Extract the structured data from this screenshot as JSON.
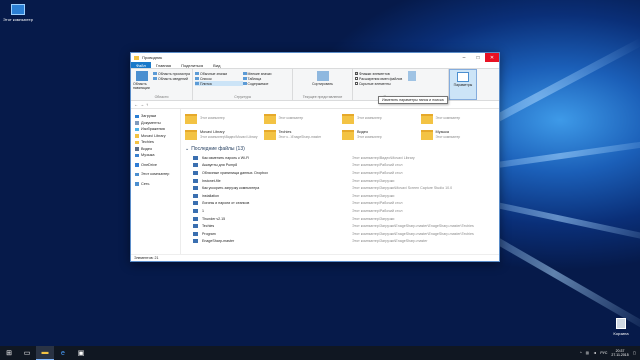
{
  "desktop": {
    "computer_icon_label": "Этот компьютер",
    "recycle_bin_label": "Корзина"
  },
  "window": {
    "title": "Проводник",
    "tabs": [
      "Файл",
      "Главная",
      "Поделиться",
      "Вид"
    ],
    "ribbon": {
      "nav_pane_label": "Область навигации",
      "pane_items": [
        "Область просмотра",
        "Область сведений"
      ],
      "pane_group_label": "Области",
      "layout_items": [
        "Обычные значки",
        "Мелкие значки",
        "Список",
        "Таблица",
        "Плитка",
        "Содержимое"
      ],
      "layout_group_label": "Структура",
      "current_view_label": "Сортировать",
      "current_view_group_label": "Текущее представление",
      "show_items": [
        {
          "label": "Флажки элементов",
          "checked": true
        },
        {
          "label": "Расширения имен файлов",
          "checked": false
        },
        {
          "label": "Скрытые элементы",
          "checked": false
        }
      ],
      "hide_button_label": "Скрыть выбранные элементы",
      "show_group_label": "Показать или скрыть",
      "options_button_label": "Параметры"
    },
    "tooltip": "Изменить параметры папок и поиска"
  },
  "nav": {
    "items": [
      {
        "label": "Загрузки",
        "icon": "download-icon"
      },
      {
        "label": "Документы",
        "icon": "documents-icon"
      },
      {
        "label": "Изображения",
        "icon": "pictures-icon"
      },
      {
        "label": "Movavi Library",
        "icon": "folder-icon"
      },
      {
        "label": "Techies",
        "icon": "folder-icon"
      },
      {
        "label": "Видео",
        "icon": "video-icon"
      },
      {
        "label": "Музыка",
        "icon": "music-icon"
      },
      {
        "label": "OneDrive",
        "icon": "cloud-icon"
      },
      {
        "label": "Этот компьютер",
        "icon": "computer-icon"
      },
      {
        "label": "Сеть",
        "icon": "network-icon"
      }
    ]
  },
  "folders": [
    {
      "name": "",
      "sub": "Этот компьютер"
    },
    {
      "name": "",
      "sub": "Этот компьютер"
    },
    {
      "name": "",
      "sub": "Этот компьютер"
    },
    {
      "name": "",
      "sub": "Этот компьютер"
    },
    {
      "name": "Movavi Library",
      "sub": "Этот компьютер\\Видео\\Movavi Library"
    },
    {
      "name": "Techies",
      "sub": "Этот к...\\EnageSharp-master"
    },
    {
      "name": "Видео",
      "sub": "Этот компьютер"
    },
    {
      "name": "Музыка",
      "sub": "Этот компьютер"
    }
  ],
  "recent": {
    "header": "Последние файлы (13)",
    "items": [
      {
        "name": "Как изменить пароль к Wi-Fi",
        "path": "Этот компьютер\\Видео\\Movavi Library"
      },
      {
        "name": "Аккаунты для Pump8",
        "path": "Этот компьютер\\Рабочий стол"
      },
      {
        "name": "Облачные хранилища данных. Dropbox",
        "path": "Этот компьютер\\Рабочий стол"
      },
      {
        "name": "Instonet-file",
        "path": "Этот компьютер\\Загрузки"
      },
      {
        "name": "Как ускорить загрузку компьютера",
        "path": "Этот компьютер\\Загрузки\\Movavi Screen Capture Studio 10.0"
      },
      {
        "name": "installation",
        "path": "Этот компьютер\\Загрузки"
      },
      {
        "name": "Логины и пароли от сеансов",
        "path": "Этот компьютер\\Рабочий стол"
      },
      {
        "name": "1",
        "path": "Этот компьютер\\Рабочий стол"
      },
      {
        "name": "Thunder v2.15",
        "path": "Этот компьютер\\Загрузки"
      },
      {
        "name": "Techies",
        "path": "Этот компьютер\\Загрузки\\EnageSharp-master\\EnageSharp-master\\Techies"
      },
      {
        "name": "Program",
        "path": "Этот компьютер\\Загрузки\\EnageSharp-master\\EnageSharp-master\\Techies"
      },
      {
        "name": "EnageSharp-master",
        "path": "Этот компьютер\\Загрузки\\EnageSharp-master"
      }
    ]
  },
  "status": {
    "items_count": "Элементов: 21"
  },
  "taskbar": {
    "lang": "РУС",
    "time": "20:37",
    "date": "27.11.2015"
  }
}
